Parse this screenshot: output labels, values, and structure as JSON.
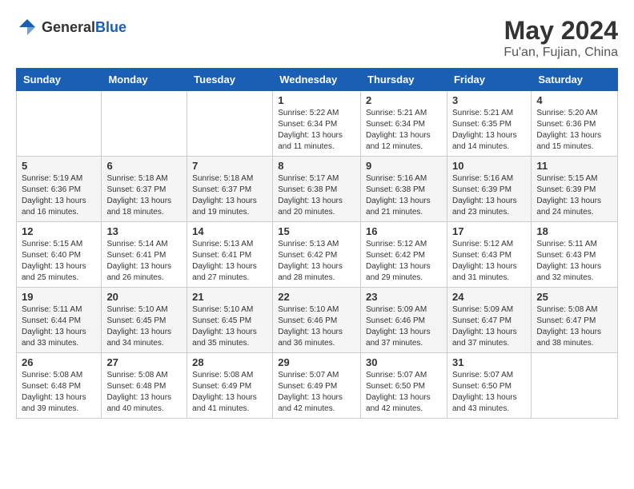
{
  "logo": {
    "general": "General",
    "blue": "Blue"
  },
  "title": {
    "month_year": "May 2024",
    "location": "Fu'an, Fujian, China"
  },
  "weekdays": [
    "Sunday",
    "Monday",
    "Tuesday",
    "Wednesday",
    "Thursday",
    "Friday",
    "Saturday"
  ],
  "weeks": [
    [
      {
        "day": "",
        "info": ""
      },
      {
        "day": "",
        "info": ""
      },
      {
        "day": "",
        "info": ""
      },
      {
        "day": "1",
        "info": "Sunrise: 5:22 AM\nSunset: 6:34 PM\nDaylight: 13 hours and 11 minutes."
      },
      {
        "day": "2",
        "info": "Sunrise: 5:21 AM\nSunset: 6:34 PM\nDaylight: 13 hours and 12 minutes."
      },
      {
        "day": "3",
        "info": "Sunrise: 5:21 AM\nSunset: 6:35 PM\nDaylight: 13 hours and 14 minutes."
      },
      {
        "day": "4",
        "info": "Sunrise: 5:20 AM\nSunset: 6:36 PM\nDaylight: 13 hours and 15 minutes."
      }
    ],
    [
      {
        "day": "5",
        "info": "Sunrise: 5:19 AM\nSunset: 6:36 PM\nDaylight: 13 hours and 16 minutes."
      },
      {
        "day": "6",
        "info": "Sunrise: 5:18 AM\nSunset: 6:37 PM\nDaylight: 13 hours and 18 minutes."
      },
      {
        "day": "7",
        "info": "Sunrise: 5:18 AM\nSunset: 6:37 PM\nDaylight: 13 hours and 19 minutes."
      },
      {
        "day": "8",
        "info": "Sunrise: 5:17 AM\nSunset: 6:38 PM\nDaylight: 13 hours and 20 minutes."
      },
      {
        "day": "9",
        "info": "Sunrise: 5:16 AM\nSunset: 6:38 PM\nDaylight: 13 hours and 21 minutes."
      },
      {
        "day": "10",
        "info": "Sunrise: 5:16 AM\nSunset: 6:39 PM\nDaylight: 13 hours and 23 minutes."
      },
      {
        "day": "11",
        "info": "Sunrise: 5:15 AM\nSunset: 6:39 PM\nDaylight: 13 hours and 24 minutes."
      }
    ],
    [
      {
        "day": "12",
        "info": "Sunrise: 5:15 AM\nSunset: 6:40 PM\nDaylight: 13 hours and 25 minutes."
      },
      {
        "day": "13",
        "info": "Sunrise: 5:14 AM\nSunset: 6:41 PM\nDaylight: 13 hours and 26 minutes."
      },
      {
        "day": "14",
        "info": "Sunrise: 5:13 AM\nSunset: 6:41 PM\nDaylight: 13 hours and 27 minutes."
      },
      {
        "day": "15",
        "info": "Sunrise: 5:13 AM\nSunset: 6:42 PM\nDaylight: 13 hours and 28 minutes."
      },
      {
        "day": "16",
        "info": "Sunrise: 5:12 AM\nSunset: 6:42 PM\nDaylight: 13 hours and 29 minutes."
      },
      {
        "day": "17",
        "info": "Sunrise: 5:12 AM\nSunset: 6:43 PM\nDaylight: 13 hours and 31 minutes."
      },
      {
        "day": "18",
        "info": "Sunrise: 5:11 AM\nSunset: 6:43 PM\nDaylight: 13 hours and 32 minutes."
      }
    ],
    [
      {
        "day": "19",
        "info": "Sunrise: 5:11 AM\nSunset: 6:44 PM\nDaylight: 13 hours and 33 minutes."
      },
      {
        "day": "20",
        "info": "Sunrise: 5:10 AM\nSunset: 6:45 PM\nDaylight: 13 hours and 34 minutes."
      },
      {
        "day": "21",
        "info": "Sunrise: 5:10 AM\nSunset: 6:45 PM\nDaylight: 13 hours and 35 minutes."
      },
      {
        "day": "22",
        "info": "Sunrise: 5:10 AM\nSunset: 6:46 PM\nDaylight: 13 hours and 36 minutes."
      },
      {
        "day": "23",
        "info": "Sunrise: 5:09 AM\nSunset: 6:46 PM\nDaylight: 13 hours and 37 minutes."
      },
      {
        "day": "24",
        "info": "Sunrise: 5:09 AM\nSunset: 6:47 PM\nDaylight: 13 hours and 37 minutes."
      },
      {
        "day": "25",
        "info": "Sunrise: 5:08 AM\nSunset: 6:47 PM\nDaylight: 13 hours and 38 minutes."
      }
    ],
    [
      {
        "day": "26",
        "info": "Sunrise: 5:08 AM\nSunset: 6:48 PM\nDaylight: 13 hours and 39 minutes."
      },
      {
        "day": "27",
        "info": "Sunrise: 5:08 AM\nSunset: 6:48 PM\nDaylight: 13 hours and 40 minutes."
      },
      {
        "day": "28",
        "info": "Sunrise: 5:08 AM\nSunset: 6:49 PM\nDaylight: 13 hours and 41 minutes."
      },
      {
        "day": "29",
        "info": "Sunrise: 5:07 AM\nSunset: 6:49 PM\nDaylight: 13 hours and 42 minutes."
      },
      {
        "day": "30",
        "info": "Sunrise: 5:07 AM\nSunset: 6:50 PM\nDaylight: 13 hours and 42 minutes."
      },
      {
        "day": "31",
        "info": "Sunrise: 5:07 AM\nSunset: 6:50 PM\nDaylight: 13 hours and 43 minutes."
      },
      {
        "day": "",
        "info": ""
      }
    ]
  ]
}
